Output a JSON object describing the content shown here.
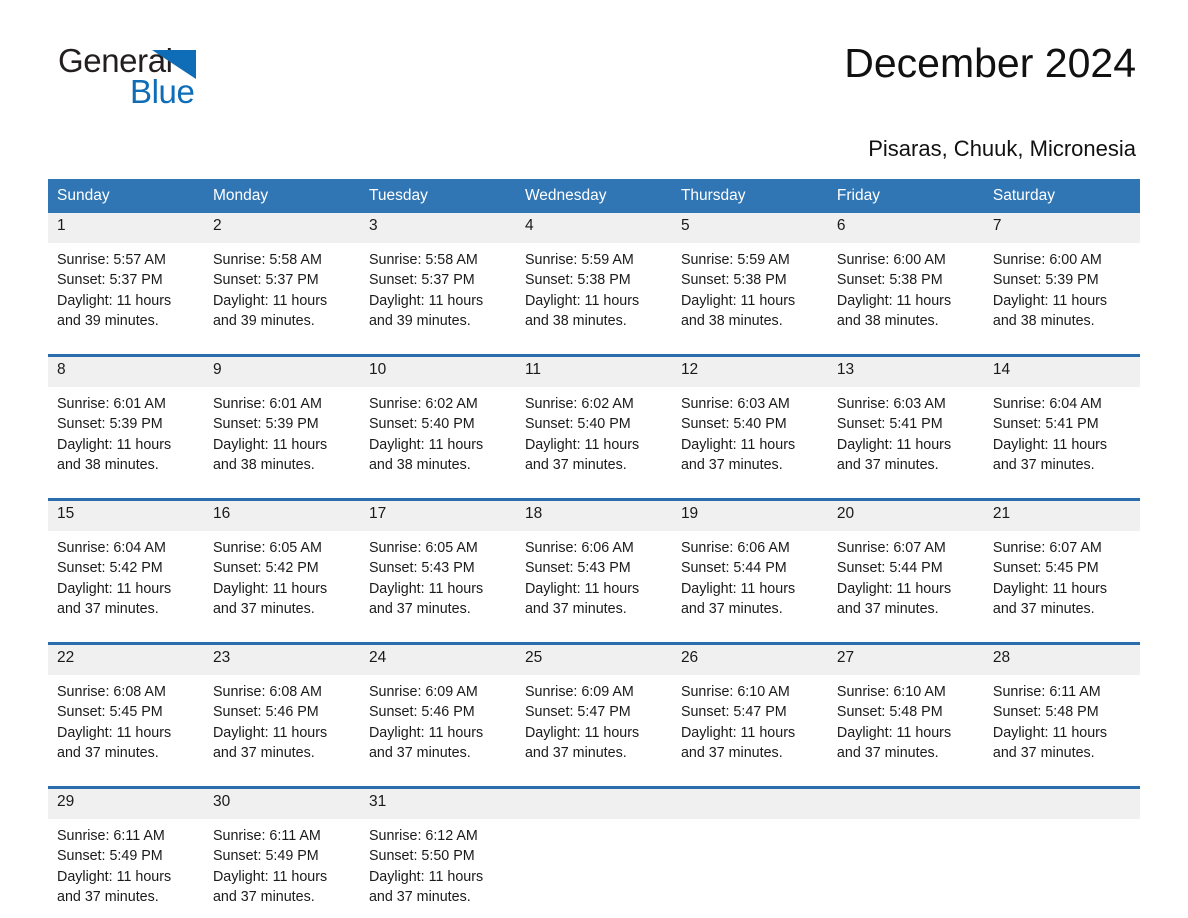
{
  "brand": {
    "word_one": "General",
    "word_two": "Blue",
    "triangle_color": "#0f6cb6",
    "text_color": "#231f20"
  },
  "header": {
    "month_title": "December 2024",
    "location": "Pisaras, Chuuk, Micronesia"
  },
  "colors": {
    "header_blue": "#3075b4",
    "separator_blue": "#2b6cad",
    "daynum_band": "#f0f0f0",
    "page_background": "#ffffff"
  },
  "calendar": {
    "weekday_headers": [
      "Sunday",
      "Monday",
      "Tuesday",
      "Wednesday",
      "Thursday",
      "Friday",
      "Saturday"
    ],
    "weeks": [
      [
        {
          "day": "1",
          "sunrise": "Sunrise: 5:57 AM",
          "sunset": "Sunset: 5:37 PM",
          "daylight_1": "Daylight: 11 hours",
          "daylight_2": "and 39 minutes."
        },
        {
          "day": "2",
          "sunrise": "Sunrise: 5:58 AM",
          "sunset": "Sunset: 5:37 PM",
          "daylight_1": "Daylight: 11 hours",
          "daylight_2": "and 39 minutes."
        },
        {
          "day": "3",
          "sunrise": "Sunrise: 5:58 AM",
          "sunset": "Sunset: 5:37 PM",
          "daylight_1": "Daylight: 11 hours",
          "daylight_2": "and 39 minutes."
        },
        {
          "day": "4",
          "sunrise": "Sunrise: 5:59 AM",
          "sunset": "Sunset: 5:38 PM",
          "daylight_1": "Daylight: 11 hours",
          "daylight_2": "and 38 minutes."
        },
        {
          "day": "5",
          "sunrise": "Sunrise: 5:59 AM",
          "sunset": "Sunset: 5:38 PM",
          "daylight_1": "Daylight: 11 hours",
          "daylight_2": "and 38 minutes."
        },
        {
          "day": "6",
          "sunrise": "Sunrise: 6:00 AM",
          "sunset": "Sunset: 5:38 PM",
          "daylight_1": "Daylight: 11 hours",
          "daylight_2": "and 38 minutes."
        },
        {
          "day": "7",
          "sunrise": "Sunrise: 6:00 AM",
          "sunset": "Sunset: 5:39 PM",
          "daylight_1": "Daylight: 11 hours",
          "daylight_2": "and 38 minutes."
        }
      ],
      [
        {
          "day": "8",
          "sunrise": "Sunrise: 6:01 AM",
          "sunset": "Sunset: 5:39 PM",
          "daylight_1": "Daylight: 11 hours",
          "daylight_2": "and 38 minutes."
        },
        {
          "day": "9",
          "sunrise": "Sunrise: 6:01 AM",
          "sunset": "Sunset: 5:39 PM",
          "daylight_1": "Daylight: 11 hours",
          "daylight_2": "and 38 minutes."
        },
        {
          "day": "10",
          "sunrise": "Sunrise: 6:02 AM",
          "sunset": "Sunset: 5:40 PM",
          "daylight_1": "Daylight: 11 hours",
          "daylight_2": "and 38 minutes."
        },
        {
          "day": "11",
          "sunrise": "Sunrise: 6:02 AM",
          "sunset": "Sunset: 5:40 PM",
          "daylight_1": "Daylight: 11 hours",
          "daylight_2": "and 37 minutes."
        },
        {
          "day": "12",
          "sunrise": "Sunrise: 6:03 AM",
          "sunset": "Sunset: 5:40 PM",
          "daylight_1": "Daylight: 11 hours",
          "daylight_2": "and 37 minutes."
        },
        {
          "day": "13",
          "sunrise": "Sunrise: 6:03 AM",
          "sunset": "Sunset: 5:41 PM",
          "daylight_1": "Daylight: 11 hours",
          "daylight_2": "and 37 minutes."
        },
        {
          "day": "14",
          "sunrise": "Sunrise: 6:04 AM",
          "sunset": "Sunset: 5:41 PM",
          "daylight_1": "Daylight: 11 hours",
          "daylight_2": "and 37 minutes."
        }
      ],
      [
        {
          "day": "15",
          "sunrise": "Sunrise: 6:04 AM",
          "sunset": "Sunset: 5:42 PM",
          "daylight_1": "Daylight: 11 hours",
          "daylight_2": "and 37 minutes."
        },
        {
          "day": "16",
          "sunrise": "Sunrise: 6:05 AM",
          "sunset": "Sunset: 5:42 PM",
          "daylight_1": "Daylight: 11 hours",
          "daylight_2": "and 37 minutes."
        },
        {
          "day": "17",
          "sunrise": "Sunrise: 6:05 AM",
          "sunset": "Sunset: 5:43 PM",
          "daylight_1": "Daylight: 11 hours",
          "daylight_2": "and 37 minutes."
        },
        {
          "day": "18",
          "sunrise": "Sunrise: 6:06 AM",
          "sunset": "Sunset: 5:43 PM",
          "daylight_1": "Daylight: 11 hours",
          "daylight_2": "and 37 minutes."
        },
        {
          "day": "19",
          "sunrise": "Sunrise: 6:06 AM",
          "sunset": "Sunset: 5:44 PM",
          "daylight_1": "Daylight: 11 hours",
          "daylight_2": "and 37 minutes."
        },
        {
          "day": "20",
          "sunrise": "Sunrise: 6:07 AM",
          "sunset": "Sunset: 5:44 PM",
          "daylight_1": "Daylight: 11 hours",
          "daylight_2": "and 37 minutes."
        },
        {
          "day": "21",
          "sunrise": "Sunrise: 6:07 AM",
          "sunset": "Sunset: 5:45 PM",
          "daylight_1": "Daylight: 11 hours",
          "daylight_2": "and 37 minutes."
        }
      ],
      [
        {
          "day": "22",
          "sunrise": "Sunrise: 6:08 AM",
          "sunset": "Sunset: 5:45 PM",
          "daylight_1": "Daylight: 11 hours",
          "daylight_2": "and 37 minutes."
        },
        {
          "day": "23",
          "sunrise": "Sunrise: 6:08 AM",
          "sunset": "Sunset: 5:46 PM",
          "daylight_1": "Daylight: 11 hours",
          "daylight_2": "and 37 minutes."
        },
        {
          "day": "24",
          "sunrise": "Sunrise: 6:09 AM",
          "sunset": "Sunset: 5:46 PM",
          "daylight_1": "Daylight: 11 hours",
          "daylight_2": "and 37 minutes."
        },
        {
          "day": "25",
          "sunrise": "Sunrise: 6:09 AM",
          "sunset": "Sunset: 5:47 PM",
          "daylight_1": "Daylight: 11 hours",
          "daylight_2": "and 37 minutes."
        },
        {
          "day": "26",
          "sunrise": "Sunrise: 6:10 AM",
          "sunset": "Sunset: 5:47 PM",
          "daylight_1": "Daylight: 11 hours",
          "daylight_2": "and 37 minutes."
        },
        {
          "day": "27",
          "sunrise": "Sunrise: 6:10 AM",
          "sunset": "Sunset: 5:48 PM",
          "daylight_1": "Daylight: 11 hours",
          "daylight_2": "and 37 minutes."
        },
        {
          "day": "28",
          "sunrise": "Sunrise: 6:11 AM",
          "sunset": "Sunset: 5:48 PM",
          "daylight_1": "Daylight: 11 hours",
          "daylight_2": "and 37 minutes."
        }
      ],
      [
        {
          "day": "29",
          "sunrise": "Sunrise: 6:11 AM",
          "sunset": "Sunset: 5:49 PM",
          "daylight_1": "Daylight: 11 hours",
          "daylight_2": "and 37 minutes."
        },
        {
          "day": "30",
          "sunrise": "Sunrise: 6:11 AM",
          "sunset": "Sunset: 5:49 PM",
          "daylight_1": "Daylight: 11 hours",
          "daylight_2": "and 37 minutes."
        },
        {
          "day": "31",
          "sunrise": "Sunrise: 6:12 AM",
          "sunset": "Sunset: 5:50 PM",
          "daylight_1": "Daylight: 11 hours",
          "daylight_2": "and 37 minutes."
        },
        {
          "day": "",
          "sunrise": "",
          "sunset": "",
          "daylight_1": "",
          "daylight_2": ""
        },
        {
          "day": "",
          "sunrise": "",
          "sunset": "",
          "daylight_1": "",
          "daylight_2": ""
        },
        {
          "day": "",
          "sunrise": "",
          "sunset": "",
          "daylight_1": "",
          "daylight_2": ""
        },
        {
          "day": "",
          "sunrise": "",
          "sunset": "",
          "daylight_1": "",
          "daylight_2": ""
        }
      ]
    ]
  }
}
